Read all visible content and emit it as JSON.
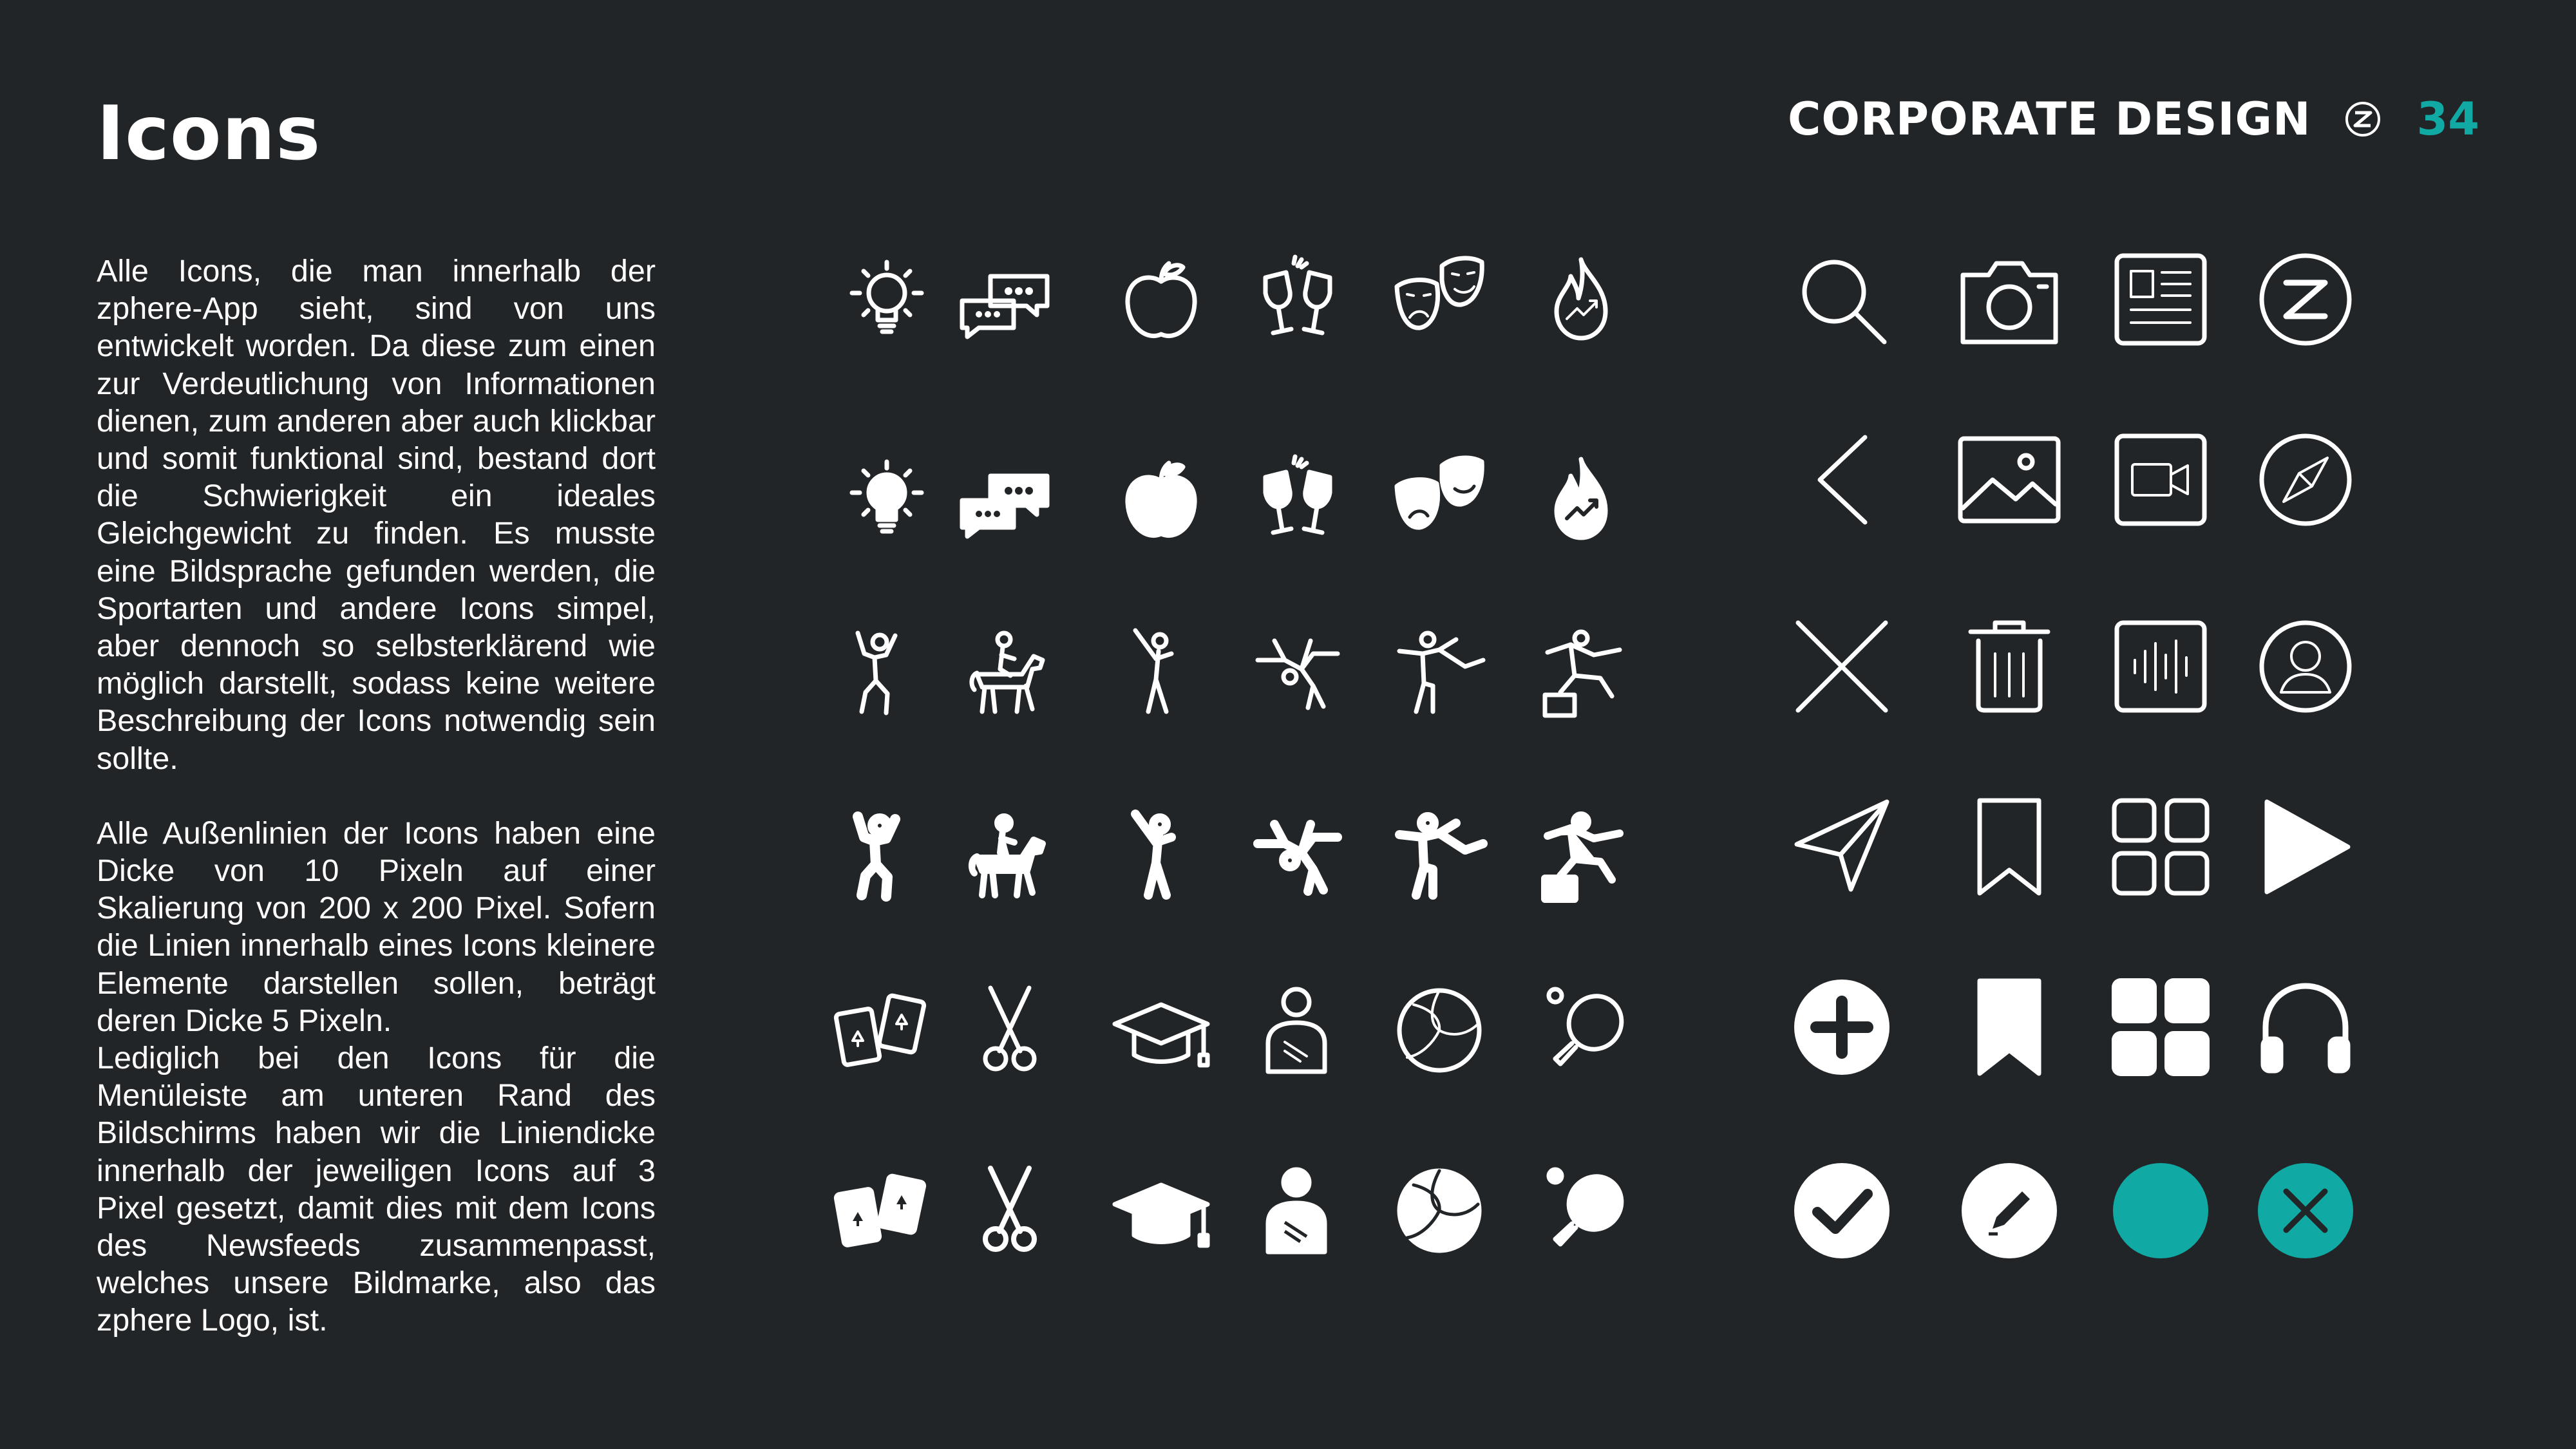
{
  "page": {
    "title": "Icons",
    "section_name": "CORPORATE DESIGN",
    "page_number": "34"
  },
  "body": {
    "paragraph_1": "Alle Icons, die man innerhalb der zphere-App sieht, sind von uns entwickelt worden. Da diese zum einen zur Verdeutlichung von Informationen dienen, zum anderen aber auch klickbar und somit funktional sind, bestand dort die Schwierigkeit ein ideales Gleichgewicht zu finden. Es musste eine Bildsprache gefunden werden, die Sportarten und andere Icons simpel, aber dennoch so selbsterklärend wie möglich darstellt, sodass keine weitere Beschreibung der Icons notwendig sein sollte.",
    "paragraph_2": "Alle Außenlinien der Icons haben eine Dicke von 10 Pixeln auf einer Skalierung von 200 x 200 Pixel. Sofern die Linien innerhalb eines Icons kleinere Elemente darstellen sollen, beträgt deren Dicke 5 Pixeln.",
    "paragraph_3": "Lediglich bei den Icons für die Menüleiste am unteren Rand des Bildschirms haben wir die Liniendicke innerhalb der jeweiligen Icons auf 3 Pixel gesetzt, damit dies mit dem Icons des Newsfeeds zusammenpasst, welches unsere Bildmarke, also das zphere Logo, ist."
  },
  "colors": {
    "background": "#222527",
    "foreground": "#ffffff",
    "accent": "#11a9a3"
  },
  "icon_grids": {
    "category_icons": [
      "lightbulb-icon",
      "chat-bubbles-icon",
      "apple-icon",
      "toast-glasses-icon",
      "theater-masks-icon",
      "flame-trend-icon",
      "cheering-person-icon",
      "horse-riding-icon",
      "golf-icon",
      "breakdance-icon",
      "karate-kick-icon",
      "parkour-icon",
      "playing-cards-icon",
      "scissors-icon",
      "graduation-cap-icon",
      "injured-person-icon",
      "volleyball-icon",
      "table-tennis-icon"
    ],
    "ui_icons": [
      "search-icon",
      "camera-icon",
      "newspaper-icon",
      "zphere-logo-icon",
      "chevron-left-icon",
      "image-icon",
      "video-icon",
      "compass-icon",
      "close-icon",
      "trash-icon",
      "audio-waveform-icon",
      "profile-icon",
      "send-icon",
      "bookmark-icon",
      "grid-icon",
      "play-icon",
      "add-circle-icon",
      "bookmark-filled-icon",
      "grid-filled-icon",
      "headphones-icon",
      "checkmark-circle-icon",
      "edit-circle-icon",
      "status-dot-icon",
      "close-circle-icon"
    ]
  }
}
